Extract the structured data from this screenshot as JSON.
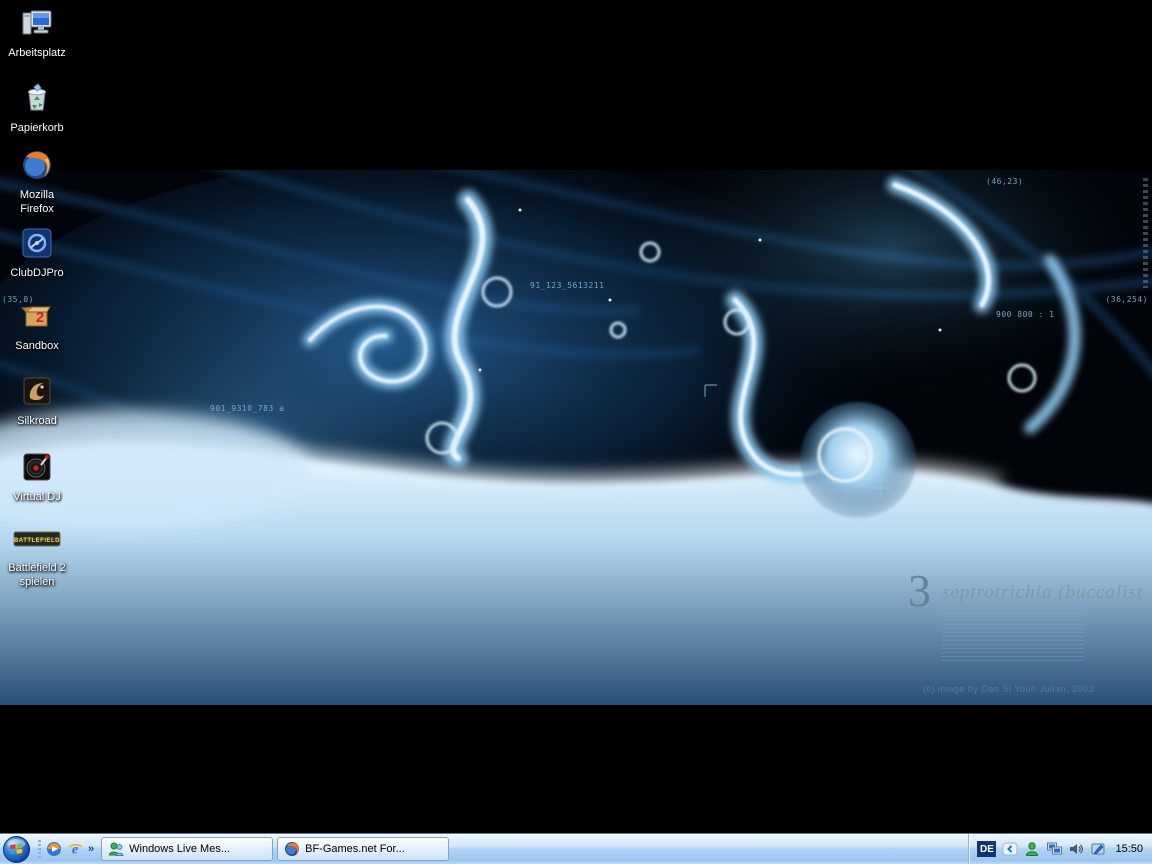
{
  "desktop": {
    "icons": [
      {
        "label": "Arbeitsplatz"
      },
      {
        "label": "Papierkorb"
      },
      {
        "label": "Mozilla Firefox"
      },
      {
        "label": "ClubDJPro"
      },
      {
        "label": "Sandbox",
        "icon_text": "2"
      },
      {
        "label": "Silkroad"
      },
      {
        "label": "Virtual DJ"
      },
      {
        "label": "Battlefield 2 spielen",
        "icon_text": "BATTLEFIELD"
      }
    ],
    "wallpaper": {
      "glyph": "3",
      "title": "septrotrichia (buccalist",
      "credit": "(c) image by Dan Si Youn Julian, 2003",
      "labels": [
        "(46,23)",
        "(35,0)",
        "(36,254)",
        "91_123_5613211",
        "901_9310_783 a",
        "900 800 : 1"
      ],
      "accent_color": "#6fb4e8"
    }
  },
  "taskbar": {
    "quick_launch": {
      "overflow_chevron": "»"
    },
    "task_buttons": [
      {
        "label": "Windows Live Mes...",
        "icon": "messenger-icon"
      },
      {
        "label": "BF-Games.net For...",
        "icon": "firefox-icon"
      }
    ],
    "tray": {
      "language": "DE",
      "clock": "15:50"
    }
  }
}
